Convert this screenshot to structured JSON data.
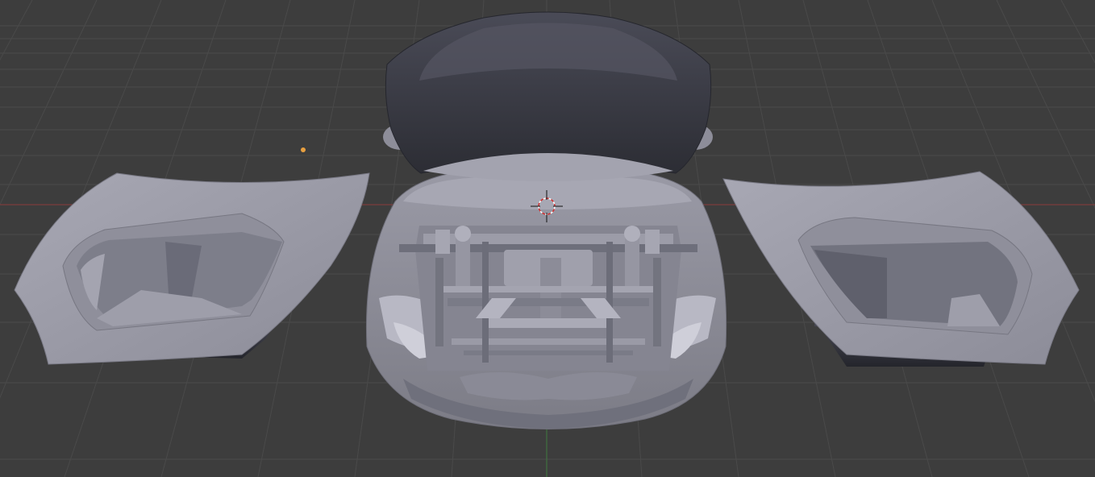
{
  "viewport": {
    "background": "#3d3d3d",
    "grid_color": "#4a4a4a",
    "x_axis_color": "#8a3c3c",
    "y_axis_color": "#3f7a3f",
    "light_icon_color": "#e8a040",
    "cursor_icon": "3d-cursor-icon",
    "light_icon": "light-source-icon"
  }
}
